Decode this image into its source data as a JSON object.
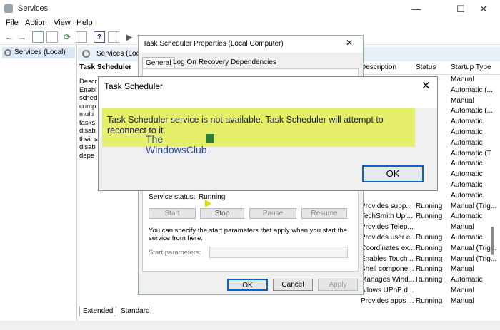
{
  "window": {
    "title": "Services",
    "min": "—",
    "max": "☐",
    "close": "✕"
  },
  "menu": [
    "File",
    "Action",
    "View",
    "Help"
  ],
  "tree": {
    "item": "Services (Local)"
  },
  "panel": {
    "header": "Services (Local",
    "selected_service": "Task Scheduler",
    "desc_lines": [
      "Descr",
      "Enabl",
      "sched",
      "comp",
      "multi",
      "tasks.",
      "disab",
      "their s",
      "disab",
      "depe"
    ]
  },
  "columns": {
    "description": "Description",
    "status": "Status",
    "startup": "Startup Type"
  },
  "rows": [
    {
      "desc": "",
      "status": "",
      "startup": "Manual"
    },
    {
      "desc": "",
      "status": "",
      "startup": "Automatic (..."
    },
    {
      "desc": "",
      "status": "",
      "startup": "Manual"
    },
    {
      "desc": "",
      "status": "",
      "startup": "Automatic (..."
    },
    {
      "desc": "",
      "status": "",
      "startup": "Automatic"
    },
    {
      "desc": "",
      "status": "",
      "startup": "Automatic"
    },
    {
      "desc": "",
      "status": "",
      "startup": "Automatic"
    },
    {
      "desc": "",
      "status": "",
      "startup": "Automatic (T"
    },
    {
      "desc": "",
      "status": "",
      "startup": "Automatic"
    },
    {
      "desc": "",
      "status": "",
      "startup": "Automatic"
    },
    {
      "desc": "",
      "status": "",
      "startup": "Automatic"
    },
    {
      "desc": "",
      "status": "",
      "startup": "Automatic"
    },
    {
      "desc": "Provides supp...",
      "status": "Running",
      "startup": "Manual (Trig..."
    },
    {
      "desc": "TechSmith Upl...",
      "status": "Running",
      "startup": "Automatic"
    },
    {
      "desc": "Provides Telep...",
      "status": "",
      "startup": "Manual"
    },
    {
      "desc": "Provides user e...",
      "status": "Running",
      "startup": "Automatic"
    },
    {
      "desc": "Coordinates ex...",
      "status": "Running",
      "startup": "Manual (Trig..."
    },
    {
      "desc": "Enables Touch ...",
      "status": "Running",
      "startup": "Manual (Trig..."
    },
    {
      "desc": "Shell compone...",
      "status": "Running",
      "startup": "Manual"
    },
    {
      "desc": "Manages Wind...",
      "status": "Running",
      "startup": "Automatic"
    },
    {
      "desc": "Allows UPnP d...",
      "status": "",
      "startup": "Manual"
    },
    {
      "desc": "Provides apps ...",
      "status": "Running",
      "startup": "Manual"
    }
  ],
  "bottom_tabs": {
    "extended": "Extended",
    "standard": "Standard"
  },
  "props": {
    "title": "Task Scheduler Properties (Local Computer)",
    "tabs": [
      "General",
      "Log On",
      "Recovery",
      "Dependencies"
    ],
    "status_label": "Service status:",
    "status_value": "Running",
    "start": "Start",
    "stop": "Stop",
    "pause": "Pause",
    "resume": "Resume",
    "hint": "You can specify the start parameters that apply when you start the service from here.",
    "params_label": "Start parameters:",
    "ok": "OK",
    "cancel": "Cancel",
    "apply": "Apply"
  },
  "message": {
    "title": "Task Scheduler",
    "text": "Task Scheduler service is not available.  Task Scheduler will attempt to reconnect to it.",
    "watermark_line1": "The",
    "watermark_line2": "WindowsClub",
    "ok": "OK"
  },
  "colors": {
    "highlight": "#e6ef6a",
    "accent": "#0a64c8"
  }
}
